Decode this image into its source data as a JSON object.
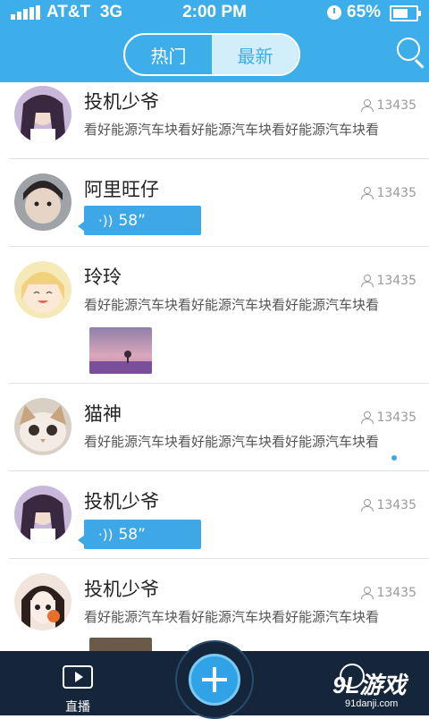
{
  "status_bar": {
    "carrier": "AT&T",
    "network": "3G",
    "time": "2:00 PM",
    "battery": "65%"
  },
  "header": {
    "tabs": [
      {
        "label": "热门",
        "active": false
      },
      {
        "label": "最新",
        "active": true
      }
    ]
  },
  "feed": {
    "items": [
      {
        "name": "投机少爷",
        "count": "13435",
        "type": "text",
        "text": "看好能源汽车块看好能源汽车块看好能源汽车块看"
      },
      {
        "name": "阿里旺仔",
        "count": "13435",
        "type": "voice",
        "voice": "58”"
      },
      {
        "name": "玲玲",
        "count": "13435",
        "type": "text+image",
        "text": "看好能源汽车块看好能源汽车块看好能源汽车块看"
      },
      {
        "name": "猫神",
        "count": "13435",
        "type": "text",
        "text": "看好能源汽车块看好能源汽车块看好能源汽车块看"
      },
      {
        "name": "投机少爷",
        "count": "13435",
        "type": "voice",
        "voice": "58”"
      },
      {
        "name": "投机少爷",
        "count": "13435",
        "type": "text",
        "text": "看好能源汽车块看好能源汽车块看好能源汽车块看"
      }
    ]
  },
  "bottom_bar": {
    "live_label": "直播",
    "watermark_big": "9L游戏",
    "watermark_small": "91danji.com"
  },
  "colors": {
    "header": "#3daee9",
    "accent": "#3ea7e6",
    "bottom_bar": "#15263b"
  }
}
